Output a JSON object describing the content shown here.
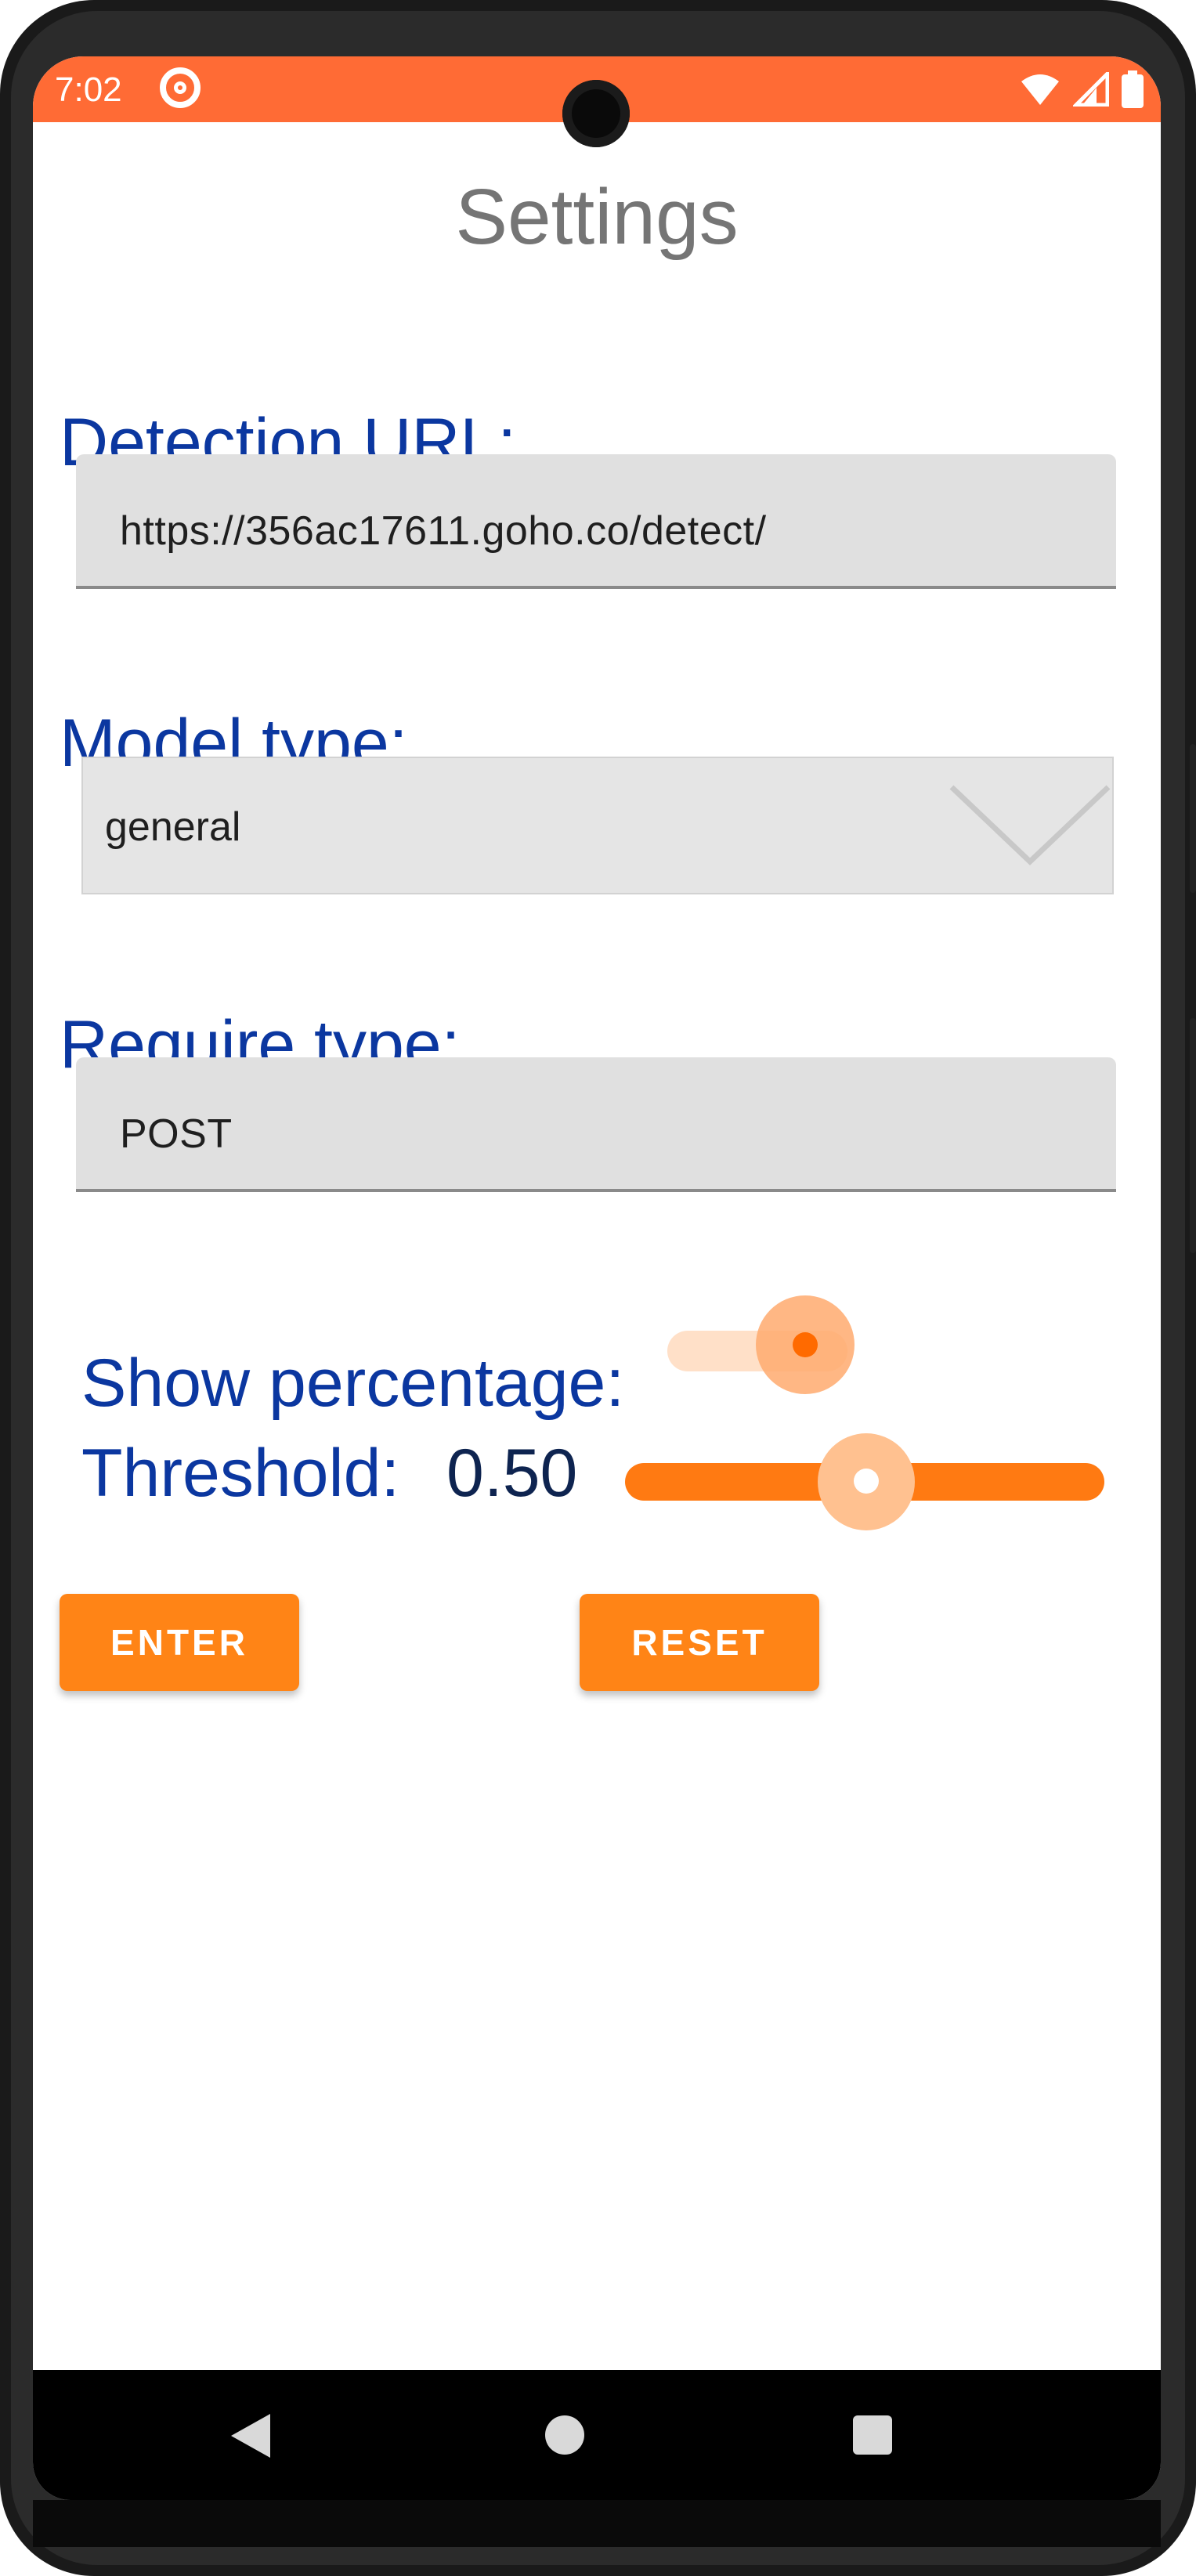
{
  "status_bar": {
    "time": "7:02",
    "accent_color": "#ff6b35"
  },
  "page": {
    "title": "Settings"
  },
  "detection_url": {
    "label": "Detection URL:",
    "value": "https://356ac17611.goho.co/detect/"
  },
  "model_type": {
    "label": "Model type:",
    "selected": "general"
  },
  "require_type": {
    "label": "Require type:",
    "value": "POST"
  },
  "show_percentage": {
    "label": "Show percentage:",
    "enabled": true
  },
  "threshold": {
    "label": "Threshold:",
    "value_text": "0.50",
    "value": 0.5
  },
  "buttons": {
    "enter": "ENTER",
    "reset": "RESET"
  },
  "colors": {
    "label": "#0b37a0",
    "button": "#ff8416",
    "slider": "#ff7a12"
  },
  "icons": [
    "camera-cutout-icon",
    "app-notification-icon",
    "wifi-icon",
    "signal-icon",
    "battery-icon",
    "chevron-down-icon",
    "back-icon",
    "home-icon",
    "recents-icon"
  ]
}
